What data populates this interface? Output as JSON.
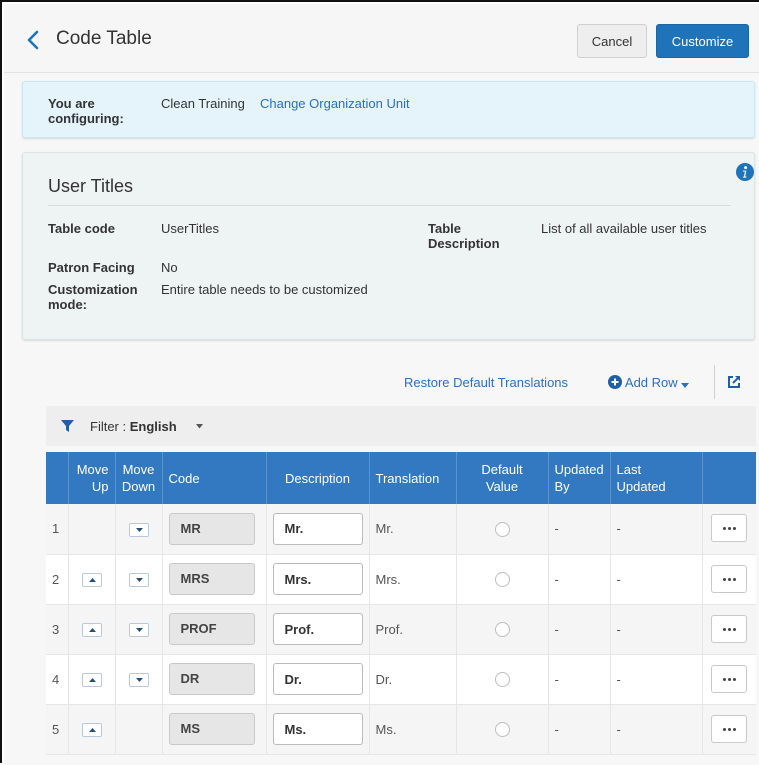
{
  "header": {
    "title": "Code Table",
    "cancel_label": "Cancel",
    "customize_label": "Customize"
  },
  "config": {
    "label_line1": "You are",
    "label_line2": "configuring:",
    "unit": "Clean Training",
    "change_link": "Change Organization Unit"
  },
  "details": {
    "title": "User Titles",
    "table_code_label": "Table code",
    "table_code_value": "UserTitles",
    "table_desc_label_line1": "Table",
    "table_desc_label_line2": "Description",
    "table_desc_value": "List of all available user titles",
    "patron_facing_label": "Patron Facing",
    "patron_facing_value": "No",
    "customization_label_line1": "Customization",
    "customization_label_line2": "mode:",
    "customization_value": "Entire table needs to be customized"
  },
  "toolbar": {
    "restore_label": "Restore Default Translations",
    "add_row_label": "Add Row"
  },
  "filter": {
    "prefix": "Filter : ",
    "value": "English"
  },
  "table": {
    "headers": {
      "move_up_1": "Move",
      "move_up_2": "Up",
      "move_down_1": "Move",
      "move_down_2": "Down",
      "code": "Code",
      "description": "Description",
      "translation": "Translation",
      "default_1": "Default",
      "default_2": "Value",
      "updated_by_1": "Updated",
      "updated_by_2": "By",
      "last_updated_1": "Last",
      "last_updated_2": "Updated"
    },
    "rows": [
      {
        "num": "1",
        "code": "MR",
        "description": "Mr.",
        "translation": "Mr.",
        "updated_by": "-",
        "last_updated": "-"
      },
      {
        "num": "2",
        "code": "MRS",
        "description": "Mrs.",
        "translation": "Mrs.",
        "updated_by": "-",
        "last_updated": "-"
      },
      {
        "num": "3",
        "code": "PROF",
        "description": "Prof.",
        "translation": "Prof.",
        "updated_by": "-",
        "last_updated": "-"
      },
      {
        "num": "4",
        "code": "DR",
        "description": "Dr.",
        "translation": "Dr.",
        "updated_by": "-",
        "last_updated": "-"
      },
      {
        "num": "5",
        "code": "MS",
        "description": "Ms.",
        "translation": "Ms.",
        "updated_by": "-",
        "last_updated": "-"
      }
    ]
  },
  "colors": {
    "primary": "#1e73b9",
    "table_header": "#3279c2",
    "link": "#2b6ec4",
    "config_bg": "#e5f4fb"
  }
}
